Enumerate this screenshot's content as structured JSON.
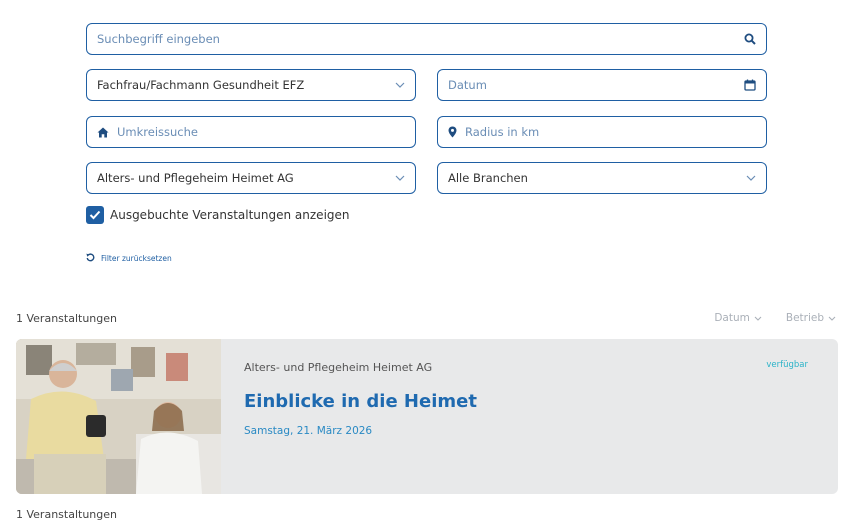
{
  "filters": {
    "search_placeholder": "Suchbegriff eingeben",
    "beruf_value": "Fachfrau/Fachmann Gesundheit EFZ",
    "datum_placeholder": "Datum",
    "umkreis_placeholder": "Umkreissuche",
    "radius_placeholder": "Radius in km",
    "betrieb_value": "Alters- und Pflegeheim Heimet AG",
    "branchen_value": "Alle Branchen",
    "checkbox_label": "Ausgebuchte Veranstaltungen anzeigen",
    "reset_label": "Filter zurücksetzen"
  },
  "results": {
    "count_label": "1 Veranstaltungen",
    "sort_datum": "Datum",
    "sort_betrieb": "Betrieb"
  },
  "events": [
    {
      "org": "Alters- und Pflegeheim Heimet AG",
      "status": "verfügbar",
      "title": "Einblicke in die Heimet",
      "date": "Samstag, 21. März 2026"
    }
  ],
  "footer": {
    "count_label": "1 Veranstaltungen"
  },
  "colors": {
    "accent": "#1f5fa3",
    "title": "#1f6ab0",
    "status": "#2bb3c8",
    "card_bg": "#e8e9ea"
  }
}
